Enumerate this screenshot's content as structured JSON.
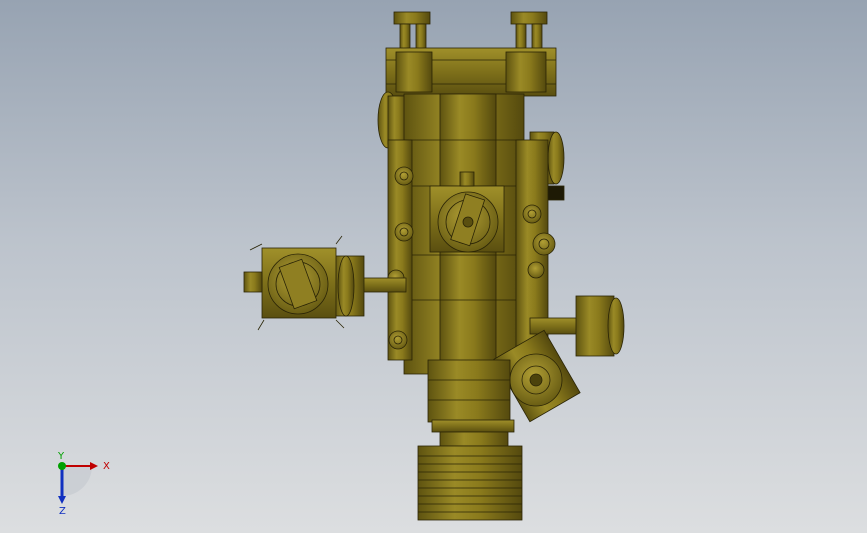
{
  "triad": {
    "x_label": "X",
    "y_label": "Y",
    "z_label": "Z",
    "x_color": "#c00000",
    "y_color": "#00a000",
    "z_color": "#1030c0"
  },
  "colors": {
    "brass": "#8a7a1c",
    "brass_light": "#a8962c",
    "brass_dark": "#4c430c",
    "outline": "#2a2406",
    "background_top": "#97a3b2",
    "background_bottom": "#dcdee0"
  }
}
